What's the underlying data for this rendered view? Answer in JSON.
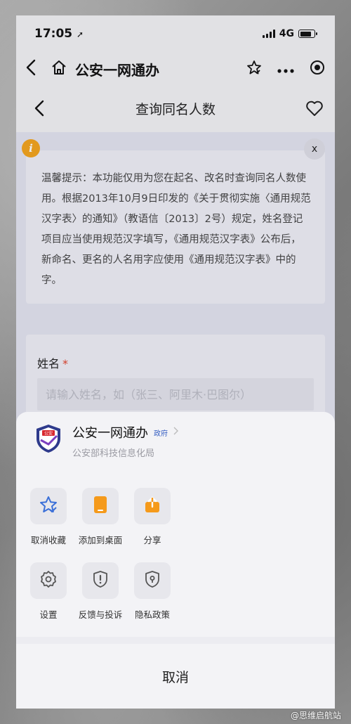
{
  "status_bar": {
    "time": "17:05",
    "location_arrow": "➚",
    "network": "4G"
  },
  "mini_program": {
    "title": "公安一网通办"
  },
  "page": {
    "title": "查询同名人数"
  },
  "notice": {
    "close_label": "x",
    "info_glyph": "i",
    "text": "温馨提示：本功能仅用为您在起名、改名时查询同名人数使用。根据2013年10月9日印发的《关于贯彻实施〈通用规范汉字表〉的通知》（教语信〔2013〕2号）规定，姓名登记项目应当使用规范汉字填写，《通用规范汉字表》公布后，新命名、更名的人名用字应使用《通用规范汉字表》中的字。"
  },
  "form": {
    "name_label": "姓名",
    "required_mark": "*",
    "name_placeholder": "请输入姓名，如（张三、阿里木·巴图尔）"
  },
  "sheet": {
    "app_name": "公安一网通办",
    "gov_tag": "政府",
    "org": "公安部科技信息化局",
    "logo_text": "公安",
    "actions": [
      {
        "label": "取消收藏",
        "icon": "star-check-icon",
        "color": "#3a6fd8"
      },
      {
        "label": "添加到桌面",
        "icon": "phone-add-icon",
        "color": "#f59a1b"
      },
      {
        "label": "分享",
        "icon": "share-icon",
        "color": "#f59a1b"
      },
      {
        "label": "设置",
        "icon": "gear-icon"
      },
      {
        "label": "反馈与投诉",
        "icon": "shield-alert-icon"
      },
      {
        "label": "隐私政策",
        "icon": "privacy-lock-icon"
      }
    ],
    "cancel_label": "取消"
  },
  "watermark": "@思维启航站"
}
